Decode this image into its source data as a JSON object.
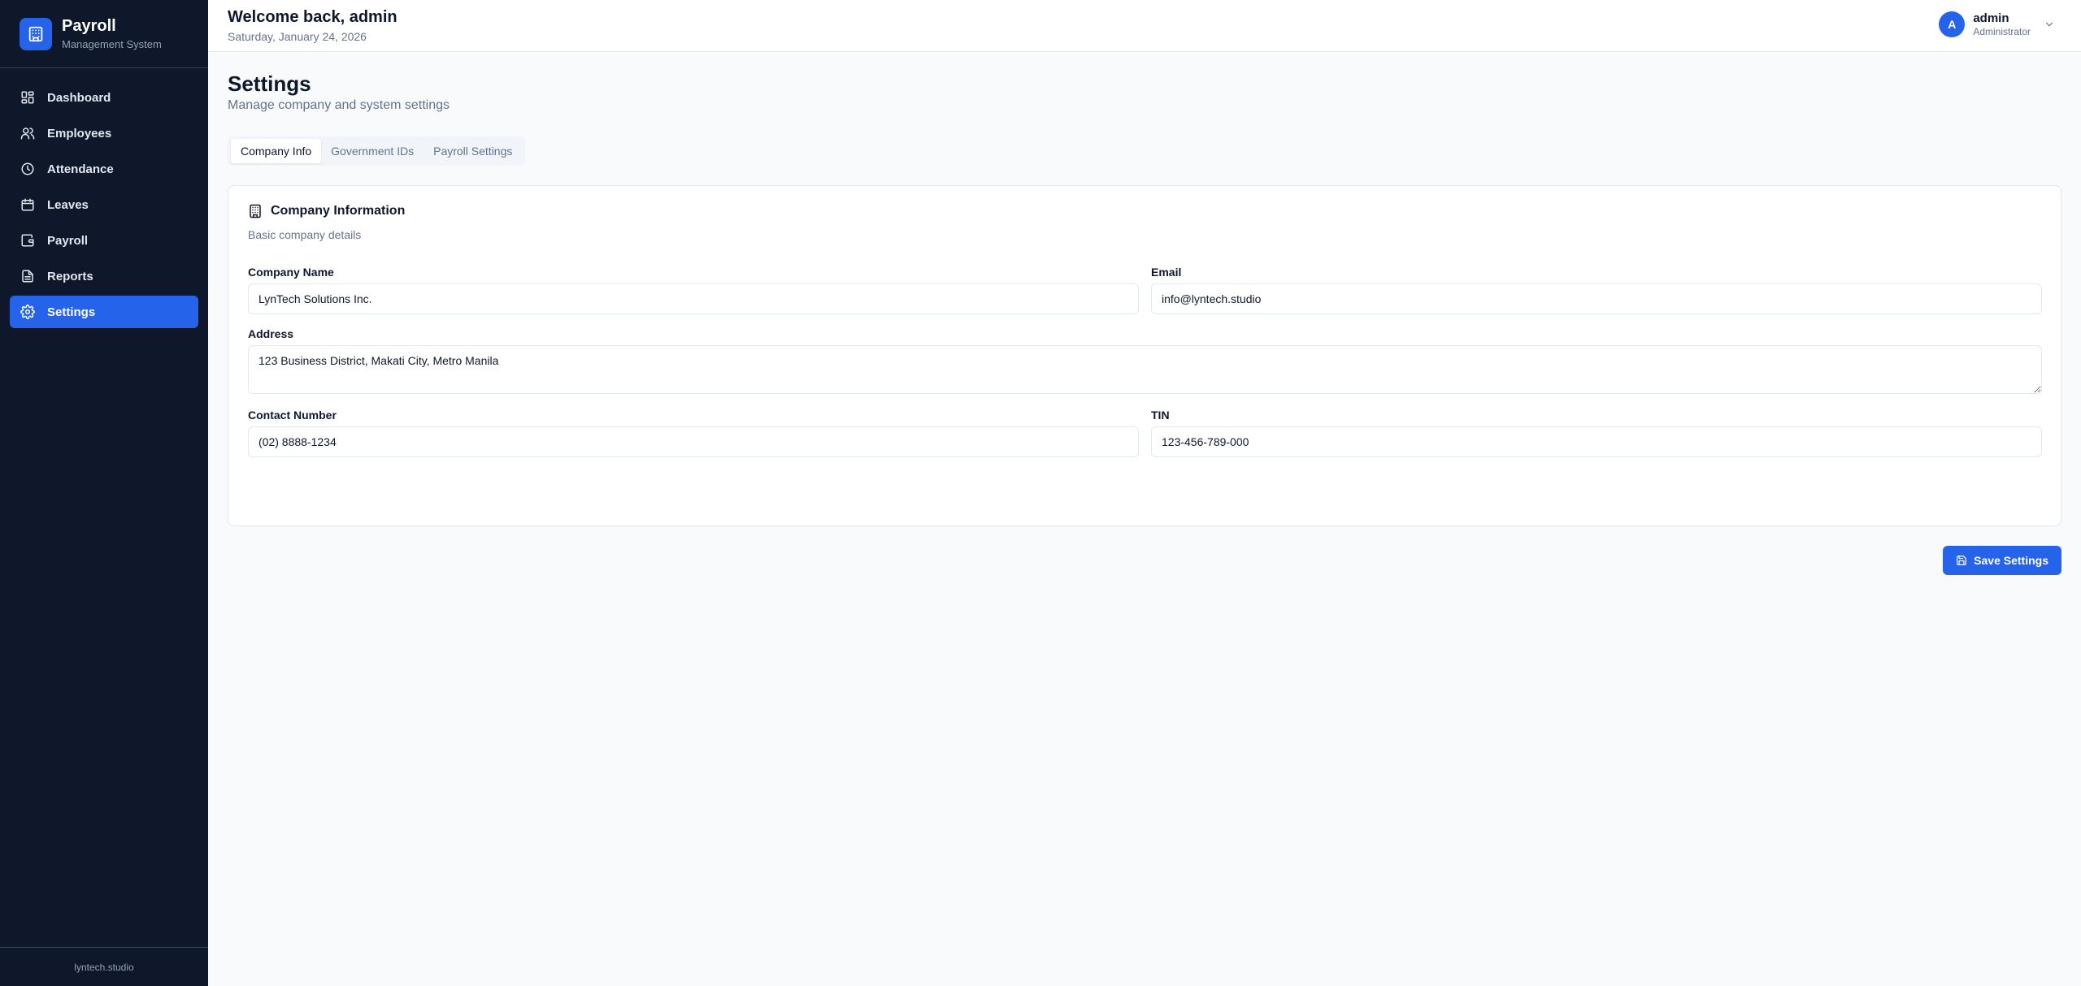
{
  "brand": {
    "title": "Payroll",
    "subtitle": "Management System",
    "icon": "building-icon"
  },
  "sidebar": {
    "items": [
      {
        "label": "Dashboard",
        "icon": "dashboard-icon",
        "active": false
      },
      {
        "label": "Employees",
        "icon": "users-icon",
        "active": false
      },
      {
        "label": "Attendance",
        "icon": "clock-icon",
        "active": false
      },
      {
        "label": "Leaves",
        "icon": "calendar-icon",
        "active": false
      },
      {
        "label": "Payroll",
        "icon": "wallet-icon",
        "active": false
      },
      {
        "label": "Reports",
        "icon": "file-text-icon",
        "active": false
      },
      {
        "label": "Settings",
        "icon": "gear-icon",
        "active": true
      }
    ],
    "footer": "lyntech.studio"
  },
  "header": {
    "welcome": "Welcome back, admin",
    "date": "Saturday, January 24, 2026",
    "user": {
      "initial": "A",
      "name": "admin",
      "role": "Administrator"
    }
  },
  "page": {
    "title": "Settings",
    "subtitle": "Manage company and system settings"
  },
  "tabs": [
    {
      "label": "Company Info",
      "active": true
    },
    {
      "label": "Government IDs",
      "active": false
    },
    {
      "label": "Payroll Settings",
      "active": false
    }
  ],
  "company": {
    "title": "Company Information",
    "description": "Basic company details",
    "fields": {
      "company_name": {
        "label": "Company Name",
        "value": "LynTech Solutions Inc."
      },
      "email": {
        "label": "Email",
        "value": "info@lyntech.studio"
      },
      "address": {
        "label": "Address",
        "value": "123 Business District, Makati City, Metro Manila"
      },
      "contact": {
        "label": "Contact Number",
        "value": "(02) 8888-1234"
      },
      "tin": {
        "label": "TIN",
        "value": "123-456-789-000"
      }
    }
  },
  "actions": {
    "save_label": "Save Settings"
  },
  "colors": {
    "sidebar_bg": "#0f172a",
    "accent": "#2563eb",
    "page_bg": "#f8fafc"
  }
}
